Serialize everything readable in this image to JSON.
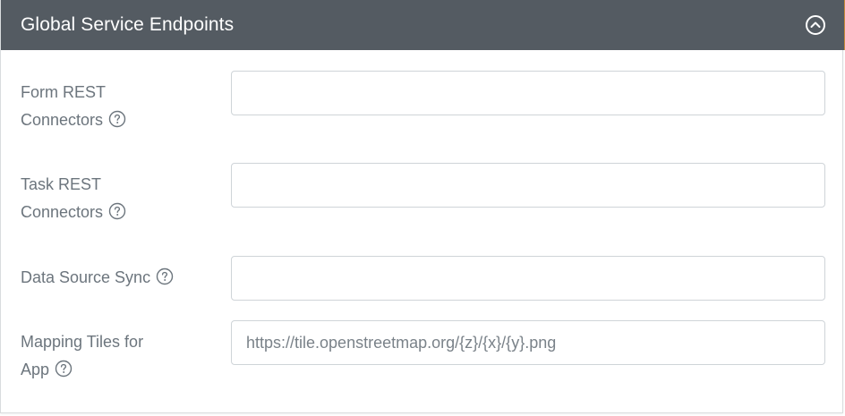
{
  "panel": {
    "title": "Global Service Endpoints",
    "collapse_icon": "chevron-up-circle-icon",
    "header_color": "#545b62"
  },
  "fields": [
    {
      "label_line1": "Form REST",
      "label_line2": "Connectors",
      "value": "",
      "placeholder": ""
    },
    {
      "label_line1": "Task REST",
      "label_line2": "Connectors",
      "value": "",
      "placeholder": ""
    },
    {
      "label_line1": "Data Source Sync",
      "value": "",
      "placeholder": ""
    },
    {
      "label_line1": "Mapping Tiles for",
      "label_line2": "App",
      "value": "",
      "placeholder": "https://tile.openstreetmap.org/{z}/{x}/{y}.png"
    }
  ],
  "help_icon": "question-circle-icon"
}
